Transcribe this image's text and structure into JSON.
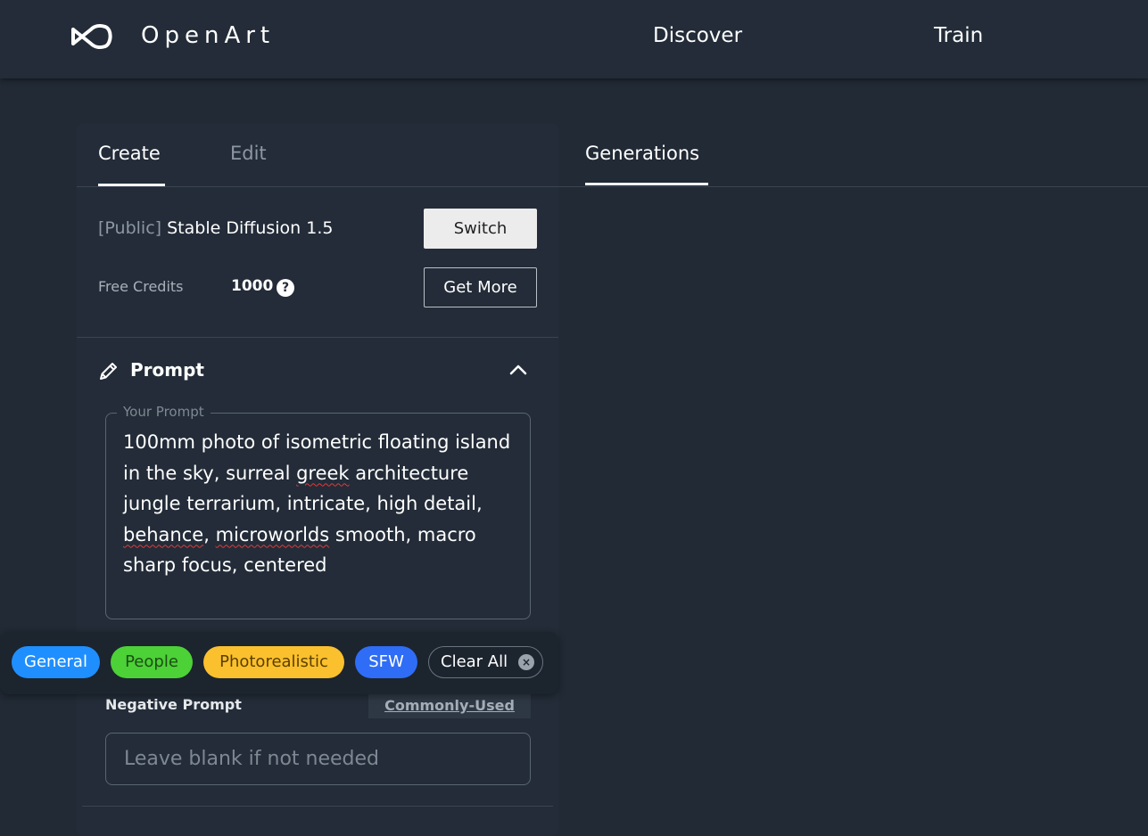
{
  "brand": {
    "name": "OpenArt",
    "icon": "infinity-logo-icon"
  },
  "nav": {
    "discover": "Discover",
    "train": "Train"
  },
  "panel": {
    "tabs": [
      {
        "label": "Create",
        "active": true
      },
      {
        "label": "Edit",
        "active": false
      }
    ],
    "model": {
      "prefix": "[Public]",
      "name": "Stable Diffusion 1.5",
      "switch_label": "Switch"
    },
    "credits": {
      "label": "Free Credits",
      "value": "1000",
      "help_icon": "question-circle-icon",
      "get_more_label": "Get More"
    },
    "prompt": {
      "title": "Prompt",
      "icon": "pencil-icon",
      "legend": "Your Prompt",
      "text_parts": [
        "100mm photo of isometric floating island in the sky, surreal ",
        "greek",
        " architecture jungle terrarium, intricate, high detail, ",
        "behance",
        ", ",
        "microworlds",
        " smooth, macro sharp focus, centered"
      ]
    },
    "negative_prompt": {
      "label": "Negative Prompt",
      "commonly_used_label": "Commonly-Used",
      "placeholder": "Leave blank if not needed",
      "value": ""
    }
  },
  "tags": [
    {
      "label": "General",
      "color": "#1f8fff"
    },
    {
      "label": "People",
      "color": "#4cd137"
    },
    {
      "label": "Photorealistic",
      "color": "#fbc02d"
    },
    {
      "label": "SFW",
      "color": "#2f6df6"
    }
  ],
  "clear_all_label": "Clear All",
  "generations": {
    "tab_label": "Generations"
  }
}
